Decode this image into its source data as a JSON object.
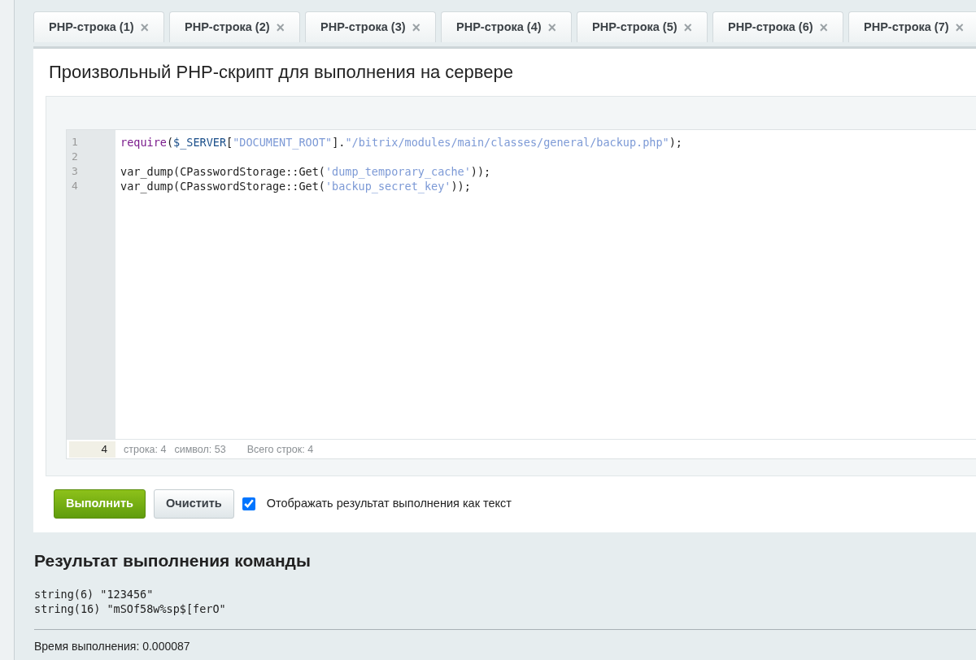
{
  "tabs": [
    {
      "label": "PHP-строка (1)",
      "close": "×"
    },
    {
      "label": "PHP-строка (2)",
      "close": "×"
    },
    {
      "label": "PHP-строка (3)",
      "close": "×"
    },
    {
      "label": "PHP-строка (4)",
      "close": "×"
    },
    {
      "label": "PHP-строка (5)",
      "close": "×"
    },
    {
      "label": "PHP-строка (6)",
      "close": "×"
    },
    {
      "label": "PHP-строка (7)",
      "close": "×"
    }
  ],
  "title": "Произвольный PHP-скрипт для выполнения на сервере",
  "editor": {
    "lines": [
      {
        "number": "1",
        "tokens": [
          {
            "kind": "keyword",
            "text": "require"
          },
          {
            "kind": "plain",
            "text": "("
          },
          {
            "kind": "variable",
            "text": "$_SERVER"
          },
          {
            "kind": "plain",
            "text": "["
          },
          {
            "kind": "string",
            "text": "\"DOCUMENT_ROOT\""
          },
          {
            "kind": "plain",
            "text": "]."
          },
          {
            "kind": "string",
            "text": "\"/bitrix/modules/main/classes/general/backup.php\""
          },
          {
            "kind": "plain",
            "text": ");"
          }
        ]
      },
      {
        "number": "2"
      },
      {
        "number": "3",
        "tokens": [
          {
            "kind": "plain",
            "text": "var_dump(CPasswordStorage::Get("
          },
          {
            "kind": "string",
            "text": "'dump_temporary_cache'"
          },
          {
            "kind": "plain",
            "text": "));"
          }
        ]
      },
      {
        "number": "4",
        "tokens": [
          {
            "kind": "plain",
            "text": "var_dump(CPasswordStorage::Get("
          },
          {
            "kind": "string",
            "text": "'backup_secret_key'"
          },
          {
            "kind": "plain",
            "text": "));"
          }
        ]
      }
    ],
    "current_line": "4",
    "status_row": "строка: 4",
    "status_char": "символ: 53",
    "status_total": "Всего строк: 4"
  },
  "buttons": {
    "run": "Выполнить",
    "clear": "Очистить"
  },
  "as_text": {
    "label": "Отображать результат выполнения как текст",
    "checked": true
  },
  "result": {
    "heading": "Результат выполнения команды",
    "output": [
      "string(6) \"123456\"",
      "string(16) \"mSOf58w%sp$[ferO\""
    ],
    "time": "Время выполнения: 0.000087"
  }
}
